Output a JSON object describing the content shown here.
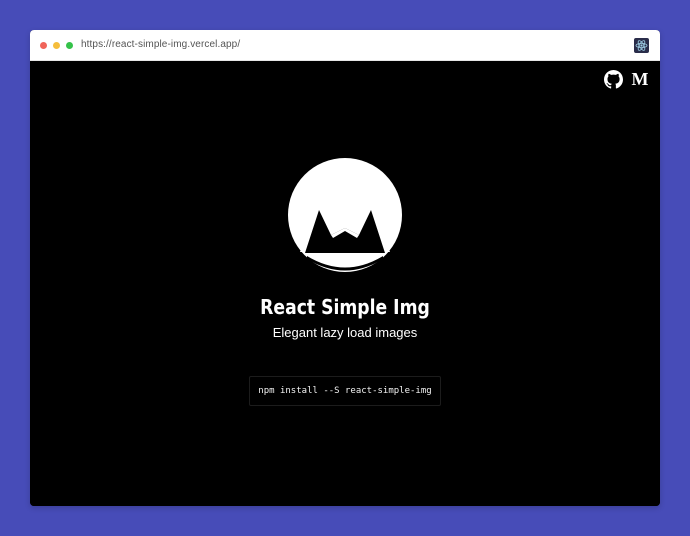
{
  "browser": {
    "url": "https://react-simple-img.vercel.app/",
    "extension_icon": "react-atom-icon"
  },
  "header": {
    "icons": [
      "github-icon",
      "medium-icon"
    ],
    "medium_letter": "M"
  },
  "hero": {
    "logo_icon": "mountain-logo-icon",
    "title": "React Simple Img",
    "subtitle": "Elegant lazy load images",
    "install_command": "npm install --S react-simple-img"
  },
  "colors": {
    "backdrop": "#474cb8",
    "page_background": "#000000",
    "text": "#ffffff"
  }
}
